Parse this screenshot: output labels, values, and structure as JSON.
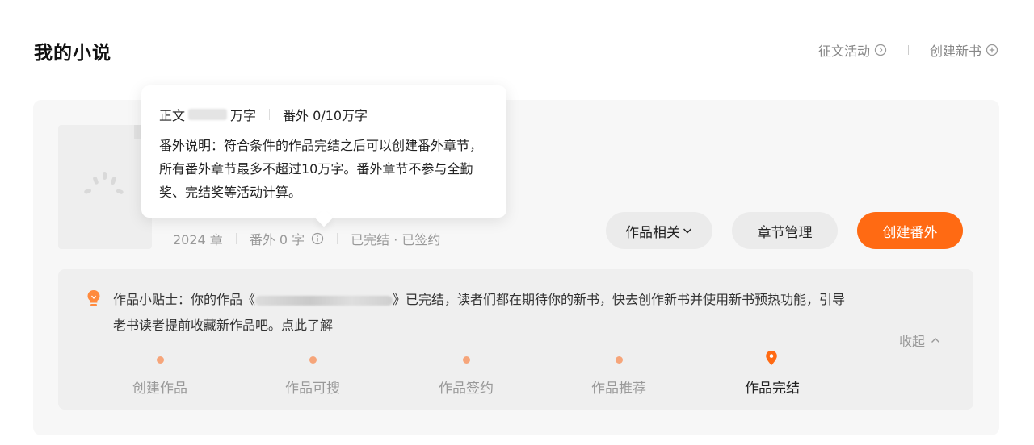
{
  "header": {
    "title": "我的小说",
    "links": [
      {
        "label": "征文活动",
        "icon": "chevron-right-circle-icon"
      },
      {
        "label": "创建新书",
        "icon": "plus-circle-icon"
      }
    ]
  },
  "book": {
    "chapters": "2024 章",
    "extra_words": "番外 0 字",
    "status": "已完结 · 已签约"
  },
  "actions": {
    "related_label": "作品相关",
    "chapter_label": "章节管理",
    "create_extra_label": "创建番外"
  },
  "tips": {
    "prefix": "作品小贴士：你的作品《",
    "suffix": "》已完结，读者们都在期待你的新书，快去创作新书并使用新书预热功能，引导老书读者提前收藏新作品吧。",
    "link": "点此了解",
    "collapse_label": "收起"
  },
  "progress": {
    "steps": [
      "创建作品",
      "作品可搜",
      "作品签约",
      "作品推荐",
      "作品完结"
    ],
    "current_index": 4
  },
  "tooltip": {
    "main_prefix": "正文",
    "main_suffix": "万字",
    "extra": "番外 0/10万字",
    "description": "番外说明：符合条件的作品完结之后可以创建番外章节，所有番外章节最多不超过10万字。番外章节不参与全勤奖、完结奖等活动计算。"
  },
  "colors": {
    "accent": "#ff6a13",
    "track": "#f6b48d",
    "bulb": "#ff8a3d"
  }
}
